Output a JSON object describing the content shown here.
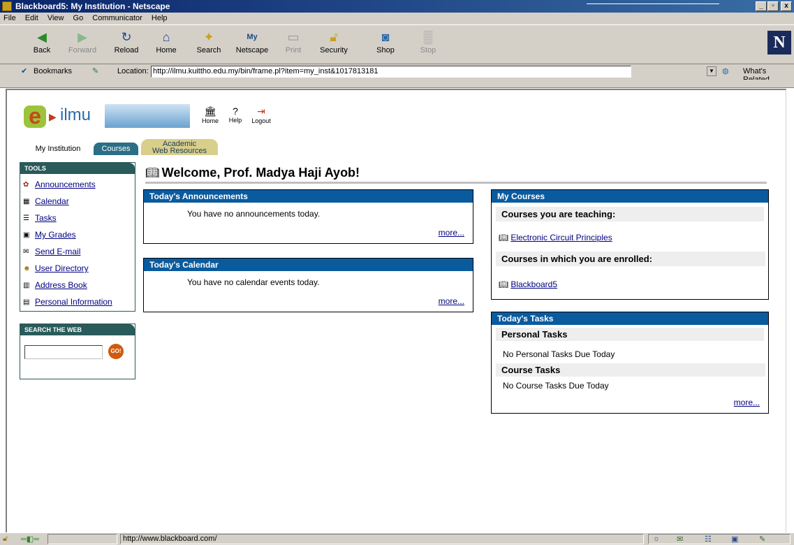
{
  "window": {
    "title": "Blackboard5: My Institution - Netscape",
    "min": "_",
    "max": "▫",
    "close": "x"
  },
  "menu": [
    "File",
    "Edit",
    "View",
    "Go",
    "Communicator",
    "Help"
  ],
  "toolbar": {
    "back": "Back",
    "forward": "Forward",
    "reload": "Reload",
    "home": "Home",
    "search": "Search",
    "netscape": "Netscape",
    "print": "Print",
    "security": "Security",
    "shop": "Shop",
    "stop": "Stop",
    "logo": "N"
  },
  "locbar": {
    "bookmarks": "Bookmarks",
    "location_label": "Location:",
    "url": "http://ilmu.kuittho.edu.my/bin/frame.pl?item=my_inst&1017813181",
    "related": "What's Related"
  },
  "site": {
    "logo_letter": "e",
    "logo_text": "ilmu",
    "nav": {
      "home": "Home",
      "help": "Help",
      "logout": "Logout"
    },
    "tabs": {
      "my_institution": "My Institution",
      "courses": "Courses",
      "academic_1": "Academic",
      "academic_2": "Web Resources"
    }
  },
  "tools": {
    "header": "TOOLS",
    "items": [
      "Announcements",
      "Calendar",
      "Tasks",
      "My Grades",
      "Send E-mail",
      "User Directory",
      "Address Book",
      "Personal Information"
    ]
  },
  "search_web": {
    "header": "SEARCH THE WEB",
    "go": "GO!"
  },
  "welcome": "Welcome, Prof. Madya Haji Ayob!",
  "announcements": {
    "header": "Today's Announcements",
    "text": "You have no announcements today.",
    "more": "more..."
  },
  "calendar": {
    "header": "Today's Calendar",
    "text": "You have no calendar events today.",
    "more": "more..."
  },
  "my_courses": {
    "header": "My Courses",
    "teaching_label": "Courses you are teaching:",
    "teaching": [
      "Electronic Circuit Principles"
    ],
    "enrolled_label": "Courses in which you are enrolled:",
    "enrolled": [
      "Blackboard5"
    ]
  },
  "tasks": {
    "header": "Today's Tasks",
    "personal_label": "Personal Tasks",
    "personal_text": "No Personal Tasks Due Today",
    "course_label": "Course Tasks",
    "course_text": "No Course Tasks Due Today",
    "more": "more..."
  },
  "status": {
    "url": "http://www.blackboard.com/"
  }
}
